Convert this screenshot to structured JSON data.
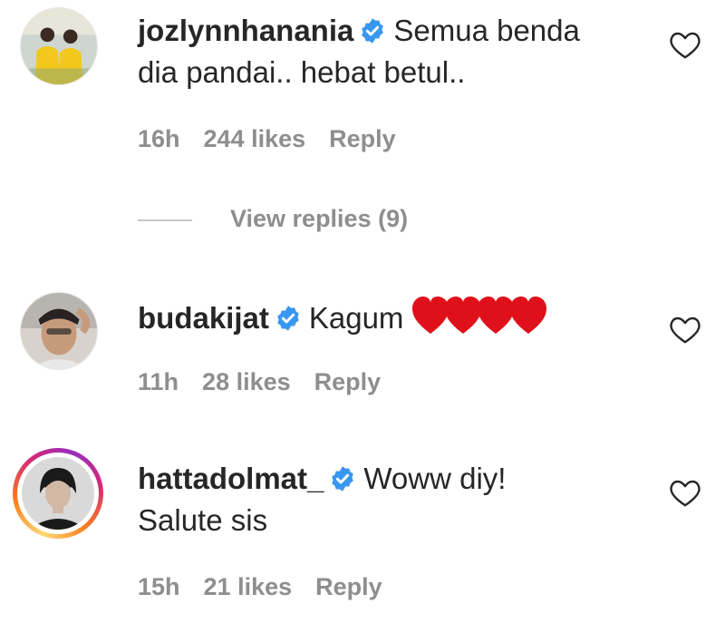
{
  "comments": [
    {
      "username": "jozlynnhanania",
      "text_line1": "Semua benda",
      "text_line2": "dia pandai.. hebat betul..",
      "time": "16h",
      "likes": "244 likes",
      "reply": "Reply",
      "avatar_icon": "avatar-photo-two-people-yellow",
      "verified_icon": "verified-badge-icon",
      "heart_icon": "heart-outline-icon"
    },
    {
      "username": "budakijat",
      "text_line1": "Kagum",
      "emoji": "❤️❤️❤️❤️",
      "time": "11h",
      "likes": "28 likes",
      "reply": "Reply",
      "avatar_icon": "avatar-photo-man",
      "verified_icon": "verified-badge-icon",
      "heart_icon": "heart-outline-icon"
    },
    {
      "username": "hattadolmat_",
      "text_line1": "Woww diy!",
      "text_line2": "Salute sis",
      "time": "15h",
      "likes": "21 likes",
      "reply": "Reply",
      "avatar_icon": "avatar-photo-story-ring",
      "verified_icon": "verified-badge-icon",
      "heart_icon": "heart-outline-icon"
    }
  ],
  "view_replies": "View replies (9)",
  "colors": {
    "text": "#262626",
    "secondary": "#8e8e8e",
    "verified": "#3897f0",
    "emoji_heart": "#e0101a"
  }
}
